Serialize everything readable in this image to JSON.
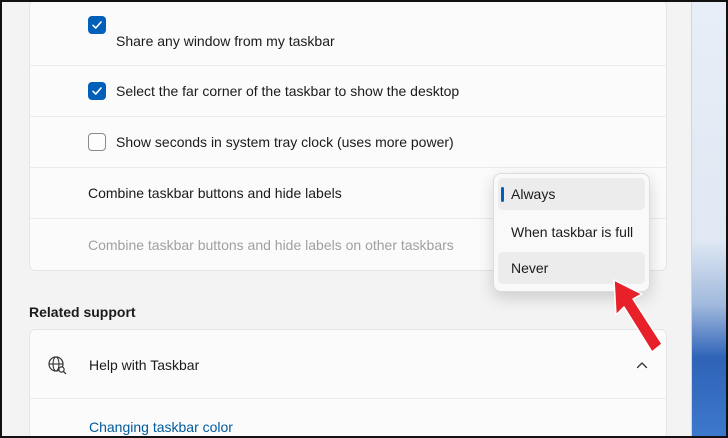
{
  "taskbar_behaviors": {
    "rows": [
      {
        "label": "Share any window from my taskbar",
        "checked": true
      },
      {
        "label": "Select the far corner of the taskbar to show the desktop",
        "checked": true
      },
      {
        "label": "Show seconds in system tray clock (uses more power)",
        "checked": false
      }
    ],
    "combine_label": "Combine taskbar buttons and hide labels",
    "combine_other_label": "Combine taskbar buttons and hide labels on other taskbars"
  },
  "dropdown": {
    "options": [
      "Always",
      "When taskbar is full",
      "Never"
    ],
    "selected": "Always",
    "hovered": "Never"
  },
  "related_support": {
    "section_title": "Related support",
    "header_title": "Help with Taskbar",
    "links": [
      "Changing taskbar color"
    ]
  },
  "colors": {
    "accent": "#005fb8",
    "link": "#005a9e",
    "annotation_arrow": "#e8202a"
  },
  "icons": {
    "help": "globe-search-icon",
    "expand": "chevron-up-icon"
  }
}
